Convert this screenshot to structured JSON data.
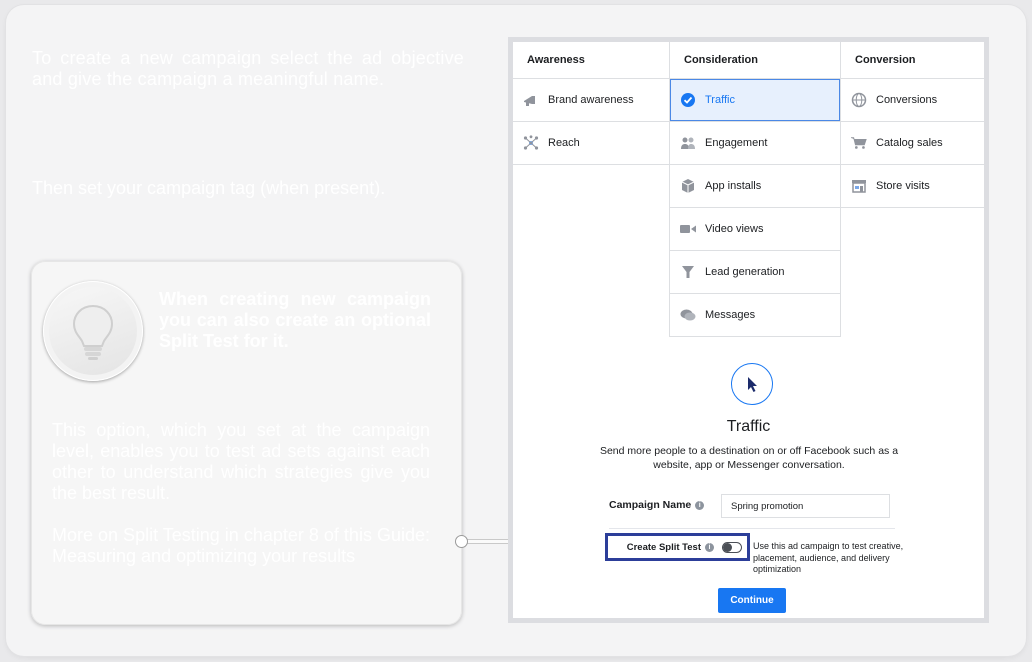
{
  "intro": {
    "text": "To create a new campaign select the ad objective and give the campaign a meaningful name.",
    "sub": "Then set your campaign tag (when present)."
  },
  "tip": {
    "headline_pre": "When creating new campaign you can also create an optional ",
    "headline_strong": "Split Test",
    "headline_post": " for it.",
    "body": "This option, which you set at the campaign level, enables you to test ad sets against each other to understand which strategies give you the best result.",
    "more": "More on Split Testing in chapter 8 of this Guide: Measuring and optimizing your results"
  },
  "objectives": {
    "awareness": {
      "header": "Awareness",
      "items": [
        {
          "label": "Brand awareness",
          "icon": "megaphone-icon"
        },
        {
          "label": "Reach",
          "icon": "reach-icon"
        }
      ]
    },
    "consideration": {
      "header": "Consideration",
      "items": [
        {
          "label": "Traffic",
          "icon": "check-circle-icon",
          "selected": true
        },
        {
          "label": "Engagement",
          "icon": "people-icon"
        },
        {
          "label": "App installs",
          "icon": "box-icon"
        },
        {
          "label": "Video views",
          "icon": "video-icon"
        },
        {
          "label": "Lead generation",
          "icon": "funnel-icon"
        },
        {
          "label": "Messages",
          "icon": "chat-icon"
        }
      ]
    },
    "conversion": {
      "header": "Conversion",
      "items": [
        {
          "label": "Conversions",
          "icon": "globe-icon"
        },
        {
          "label": "Catalog sales",
          "icon": "cart-icon"
        },
        {
          "label": "Store visits",
          "icon": "store-icon"
        }
      ]
    }
  },
  "detail": {
    "icon": "cursor-icon",
    "title": "Traffic",
    "description": "Send more people to a destination on or off Facebook such as a website, app or Messenger conversation."
  },
  "campaign": {
    "name_label": "Campaign Name",
    "name_value": "Spring promotion"
  },
  "split_test": {
    "label": "Create Split Test",
    "enabled": false,
    "description": "Use this ad campaign to test creative, placement, audience, and delivery optimization"
  },
  "continue_label": "Continue",
  "colors": {
    "accent": "#1877f2",
    "highlight_border": "#2c3e99",
    "selected_bg": "#e7f0fd"
  }
}
